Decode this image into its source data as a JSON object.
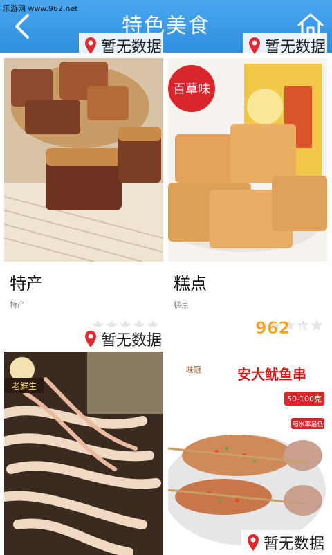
{
  "watermark": "乐游网 www.962.net",
  "header": {
    "title": "特色美食"
  },
  "cards": [
    {
      "name": "特产",
      "subtitle": "特产",
      "badge": "暂无数据",
      "rating": 0
    },
    {
      "name": "糕点",
      "subtitle": "糕点",
      "badge": "暂无数据",
      "rating": 0
    },
    {
      "name": "",
      "subtitle": "",
      "badge": "暂无数据",
      "image_text": "老鲜生",
      "rating": 0
    },
    {
      "name": "",
      "subtitle": "",
      "badge": "暂无数据",
      "image_text": "安大鱿鱼串",
      "image_text2": "50-100克",
      "image_text3": "缩水率最低",
      "brand": "味冠",
      "rating": 0
    }
  ],
  "pastry_brand": "百草味",
  "footer_logo": {
    "number": "962",
    "suffix": ".NET",
    "cn": "乐游网"
  },
  "colors": {
    "header": "#3b9be8",
    "badge_pin": "#e0282e"
  }
}
